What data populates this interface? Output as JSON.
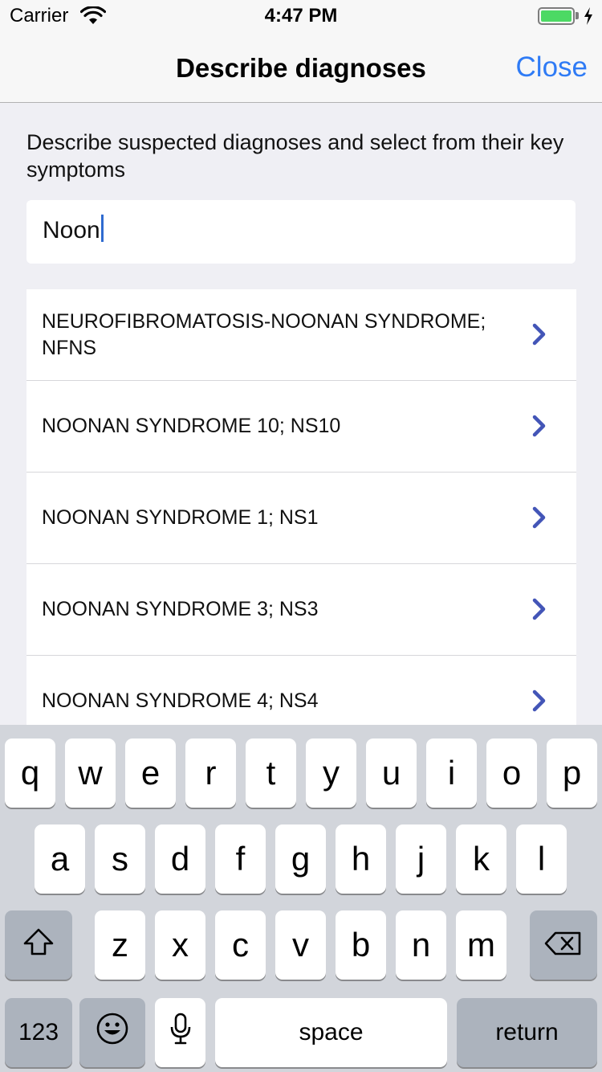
{
  "status_bar": {
    "carrier": "Carrier",
    "time": "4:47 PM",
    "battery_level": 1.0,
    "battery_color": "#4cd964",
    "icons": [
      "wifi-icon",
      "battery-icon",
      "charging-bolt-icon"
    ]
  },
  "nav": {
    "title": "Describe diagnoses",
    "close_label": "Close",
    "accent_color": "#2f7bf5"
  },
  "instructions": "Describe suspected diagnoses and select from their key symptoms",
  "search": {
    "value": "Noon"
  },
  "results": [
    {
      "label": "NEUROFIBROMATOSIS-NOONAN SYNDROME; NFNS"
    },
    {
      "label": "NOONAN SYNDROME 10; NS10"
    },
    {
      "label": "NOONAN SYNDROME 1; NS1"
    },
    {
      "label": "NOONAN SYNDROME 3; NS3"
    },
    {
      "label": "NOONAN SYNDROME 4; NS4"
    }
  ],
  "keyboard": {
    "row1": [
      "q",
      "w",
      "e",
      "r",
      "t",
      "y",
      "u",
      "i",
      "o",
      "p"
    ],
    "row2": [
      "a",
      "s",
      "d",
      "f",
      "g",
      "h",
      "j",
      "k",
      "l"
    ],
    "row3": [
      "z",
      "x",
      "c",
      "v",
      "b",
      "n",
      "m"
    ],
    "numbers_label": "123",
    "space_label": "space",
    "return_label": "return",
    "special_keys": [
      "shift-icon",
      "backspace-icon",
      "emoji-icon",
      "microphone-icon"
    ]
  }
}
